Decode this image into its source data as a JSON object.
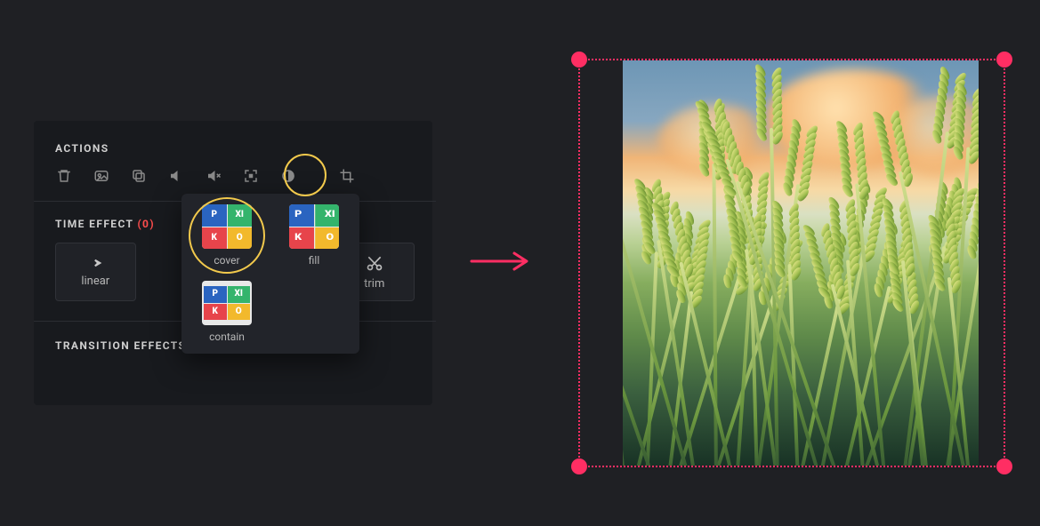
{
  "panel": {
    "actions_title": "ACTIONS",
    "icons": {
      "trash": "trash-icon",
      "image": "image-icon",
      "copy": "copy-icon",
      "volume": "volume-icon",
      "mute": "mute-icon",
      "fit": "fit-icon",
      "contrast": "contrast-icon",
      "crop": "crop-icon"
    },
    "time_effect_title": "TIME EFFECT",
    "time_effect_count": "(0)",
    "effects": {
      "linear": "linear",
      "trim": "trim"
    },
    "transition_title": "TRANSITION EFFECTS:"
  },
  "popover": {
    "cover": "cover",
    "fill": "fill",
    "contain": "contain"
  },
  "highlight_color": "#f2c94c",
  "accent_color": "#ff2e63"
}
